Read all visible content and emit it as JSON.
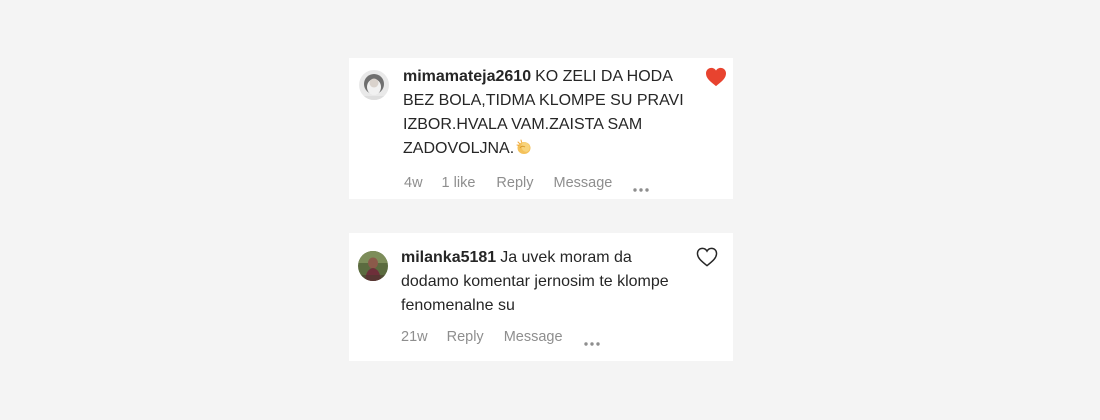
{
  "comments": [
    {
      "username": "mimamateja2610",
      "text": "KO ZELI DA HODA BEZ BOLA,TIDMA KLOMPE SU PRAVI IZBOR.HVALA VAM.ZAISTA SAM ZADOVOLJNA.",
      "emoji": "clapping-hands",
      "liked": true,
      "heart_color": "#ed4956",
      "age": "4w",
      "likes": "1 like",
      "reply_label": "Reply",
      "message_label": "Message",
      "more_icon": "ellipsis-icon"
    },
    {
      "username": "milanka5181",
      "text": "Ja uvek moram da dodamo komentar jernosim te klompe fenomenalne su",
      "liked": false,
      "heart_color": "#262626",
      "age": "21w",
      "reply_label": "Reply",
      "message_label": "Message",
      "more_icon": "ellipsis-icon"
    }
  ],
  "colors": {
    "background": "#f4f4f4",
    "card": "#ffffff",
    "text": "#262626",
    "secondary_text": "#8e8e8e",
    "heart_liked": "#ed4956"
  }
}
